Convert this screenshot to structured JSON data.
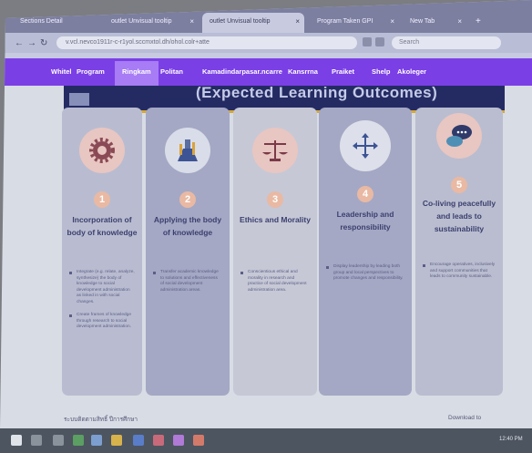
{
  "browser": {
    "tabs": [
      {
        "label": "Sections Detail"
      },
      {
        "label": "outlet Unvisual tooltip"
      },
      {
        "label": "outlet Unvisual tooltip",
        "active": true
      },
      {
        "label": "Program Taken GPI"
      },
      {
        "label": "New Tab"
      }
    ],
    "url": "v.vcl.nevco1911r-c-r1yol.sccmxtol.dh/ohol.colr+atte",
    "search_placeholder": "Search"
  },
  "navbar": {
    "items": [
      "Whitel",
      "Program",
      "Ringkam",
      "Politan",
      "Kamadindarpasar.ncarre",
      "Kansrrna",
      "Praiket",
      "Shelp",
      "Akoleger"
    ]
  },
  "banner": {
    "title": "(Expected Learning Outcomes)"
  },
  "cards": [
    {
      "number": "1",
      "title": "Incorporation of body of knowledge",
      "bullets": [
        "Integrate (e.g. relate, analyze, synthesize) the body of knowledge to social development administration as linked in with social changes.",
        "Create frames of knowledge through research to social development administration."
      ],
      "icon": "gear-icon",
      "color": "#b9bcd0",
      "icon_bg": "#e8c6c2"
    },
    {
      "number": "2",
      "title": "Applying the body of knowledge",
      "bullets": [
        "Transfer academic knowledge to solutions and effectiveness of social development administration areas."
      ],
      "icon": "lab-flask-icon",
      "color": "#a4a8c4",
      "icon_bg": "#d9dde9"
    },
    {
      "number": "3",
      "title": "Ethics and Morality",
      "bullets": [
        "Conscientious ethical and morality in research and practice of social development administration area."
      ],
      "icon": "scales-icon",
      "color": "#c6c8d6",
      "icon_bg": "#e8c6c2"
    },
    {
      "number": "4",
      "title": "Leadership and responsibility",
      "bullets": [
        "Display leadership by leading both group and local perspectives to promote changes and responsibility."
      ],
      "icon": "move-arrows-icon",
      "color": "#a4a8c4",
      "icon_bg": "#dde0ea"
    },
    {
      "number": "5",
      "title": "Co-living peacefully and leads to sustainability",
      "bullets": [
        "Encourage operatives, inclusively and support communities that leads to community sustainable."
      ],
      "icon": "chat-bubbles-icon",
      "color": "#babdcf",
      "icon_bg": "#e8c6c2"
    }
  ],
  "footer": {
    "left": "ระบบติดตามสิทธิ์ ปีการศึกษา",
    "right": "Download to"
  },
  "taskbar": {
    "clock": "12:40 PM"
  }
}
